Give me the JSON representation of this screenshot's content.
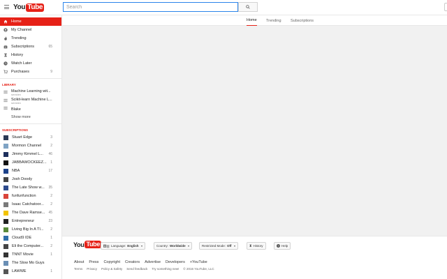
{
  "header": {
    "logo_you": "You",
    "logo_tube": "Tube",
    "locale_tag": "IN",
    "search_placeholder": "Search"
  },
  "sidebar": {
    "nav": [
      {
        "label": "Home",
        "icon": "home-icon",
        "active": true
      },
      {
        "label": "My Channel",
        "icon": "person-icon"
      },
      {
        "label": "Trending",
        "icon": "flame-icon"
      },
      {
        "label": "Subscriptions",
        "icon": "subscriptions-icon",
        "count": "65"
      },
      {
        "label": "History",
        "icon": "hourglass-icon"
      },
      {
        "label": "Watch Later",
        "icon": "clock-icon"
      },
      {
        "label": "Purchases",
        "icon": "cart-icon",
        "count": "9"
      }
    ],
    "library_title": "LIBRARY",
    "library": [
      {
        "title": "Machine Learning wit...",
        "sub": "sentdex"
      },
      {
        "title": "Scikit-learn Machine L...",
        "sub": "sentdex"
      },
      {
        "title": "Blake"
      }
    ],
    "show_more": "Show more",
    "subscriptions_title": "SUBSCRIPTIONS",
    "subscriptions": [
      {
        "name": "Stuart Edge",
        "count": "3",
        "color": "#2b3a55"
      },
      {
        "name": "Mormon Channel",
        "count": "2",
        "color": "#7fa3c4"
      },
      {
        "name": "Jimmy Kimmel L...",
        "count": "46",
        "color": "#1d2f5c"
      },
      {
        "name": "JABBAWOCKEEZ...",
        "count": "1",
        "color": "#111111"
      },
      {
        "name": "NBA",
        "count": "17",
        "color": "#1d428a"
      },
      {
        "name": "Josh Doody",
        "count": "",
        "color": "#444444"
      },
      {
        "name": "The Late Show w...",
        "count": "35",
        "color": "#2d4a8c"
      },
      {
        "name": "funfunfunction",
        "count": "2",
        "color": "#d9443a"
      },
      {
        "name": "Isaac Catchatoor...",
        "count": "2",
        "color": "#7a7a7a"
      },
      {
        "name": "The Dave Ramse...",
        "count": "45",
        "color": "#f2c300"
      },
      {
        "name": "Entrepreneur",
        "count": "23",
        "color": "#222222"
      },
      {
        "name": "Living Big In A TI...",
        "count": "2",
        "color": "#5a8a3a"
      },
      {
        "name": "Cloud9 IDE",
        "count": "1",
        "color": "#2f6ea9"
      },
      {
        "name": "Eli the Computer...",
        "count": "2",
        "color": "#444444"
      },
      {
        "name": "TNNT Movie",
        "count": "1",
        "color": "#333333"
      },
      {
        "name": "The Slow Mo Guys",
        "count": "",
        "color": "#6a8fb5"
      },
      {
        "name": "LAWWE",
        "count": "1",
        "color": "#555555"
      }
    ]
  },
  "tabs": [
    {
      "label": "Home",
      "active": true
    },
    {
      "label": "Trending"
    },
    {
      "label": "Subscriptions"
    }
  ],
  "footer": {
    "logo_you": "You",
    "logo_tube": "Tube",
    "language_label": "Language:",
    "language_value": "English",
    "country_label": "Country:",
    "country_value": "Worldwide",
    "restricted_label": "Restricted Mode:",
    "restricted_value": "Off",
    "history_label": "History",
    "help_label": "Help",
    "links_primary": [
      "About",
      "Press",
      "Copyright",
      "Creators",
      "Advertise",
      "Developers",
      "+YouTube"
    ],
    "links_secondary": [
      "Terms",
      "Privacy",
      "Policy & Safety",
      "Send feedback",
      "Try something new!"
    ],
    "copyright": "© 2016 YouTube, LLC"
  },
  "colors": {
    "brand_red": "#e62117",
    "search_border": "#2b84ea"
  }
}
